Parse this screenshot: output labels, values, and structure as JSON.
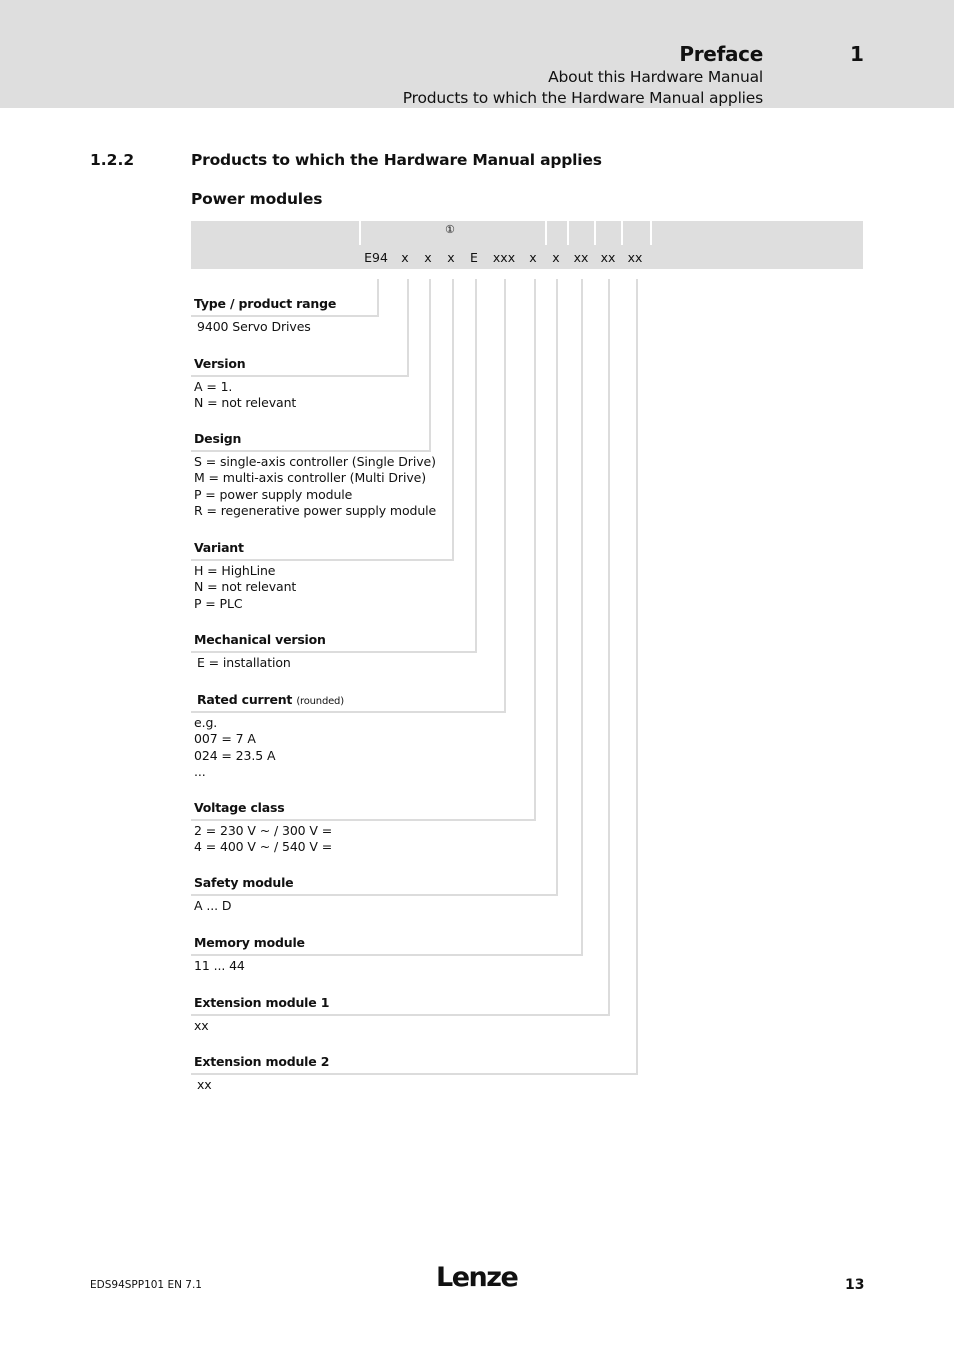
{
  "header": {
    "chapter_title": "Preface",
    "chapter_number": "1",
    "subtitle_1": "About this Hardware Manual",
    "subtitle_2": "Products to which the Hardware Manual applies"
  },
  "section": {
    "number": "1.2.2",
    "title": "Products to which the Hardware Manual applies",
    "subheading": "Power modules"
  },
  "type_code": {
    "marker": "①",
    "segments": [
      "E94",
      "x",
      "x",
      "x",
      "E",
      "xxx",
      "x",
      "x",
      "xx",
      "xx",
      "xx"
    ]
  },
  "fields": [
    {
      "label": "Type / product range",
      "note": "",
      "values": [
        "9400 Servo Drives"
      ]
    },
    {
      "label": "Version",
      "note": "",
      "values": [
        "A = 1.",
        "N = not relevant"
      ]
    },
    {
      "label": "Design",
      "note": "",
      "values": [
        "S = single-axis controller (Single Drive)",
        "M = multi-axis controller (Multi Drive)",
        "P = power supply module",
        "R = regenerative power supply module"
      ]
    },
    {
      "label": "Variant",
      "note": "",
      "values": [
        "H = HighLine",
        "N = not relevant",
        "P = PLC"
      ]
    },
    {
      "label": "Mechanical version",
      "note": "",
      "values": [
        "E = installation"
      ]
    },
    {
      "label": "Rated current",
      "note": "(rounded)",
      "values": [
        "e.g.",
        "007 = 7 A",
        "024 = 23.5 A",
        "..."
      ]
    },
    {
      "label": "Voltage class",
      "note": "",
      "values": [
        "2 = 230 V ~ / 300 V =",
        "4 = 400 V ~ / 540 V ="
      ]
    },
    {
      "label": "Safety module",
      "note": "",
      "values": [
        "A ... D"
      ]
    },
    {
      "label": "Memory module",
      "note": "",
      "values": [
        "11 ... 44"
      ]
    },
    {
      "label": "Extension module 1",
      "note": "",
      "values": [
        "xx"
      ]
    },
    {
      "label": "Extension module 2",
      "note": "",
      "values": [
        "xx"
      ]
    }
  ],
  "footer": {
    "doc_id": "EDS94SPP101  EN  7.1",
    "logo": "Lenze",
    "page_number": "13"
  }
}
